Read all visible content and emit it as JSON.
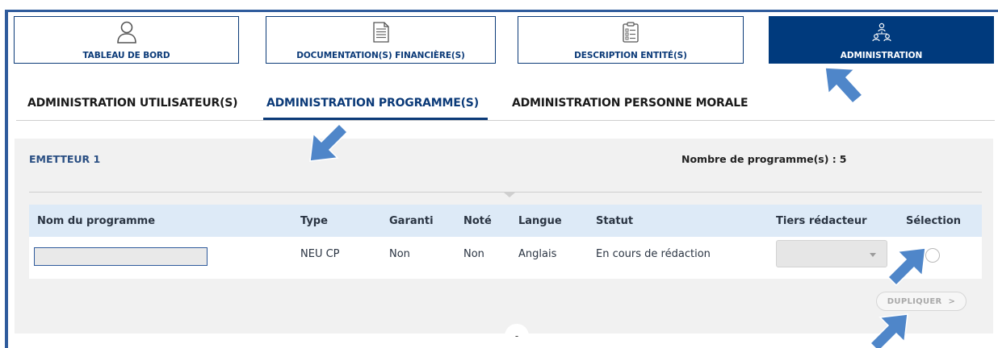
{
  "nav_tiles": [
    {
      "label": "TABLEAU DE BORD",
      "icon": "user-icon",
      "active": false
    },
    {
      "label": "DOCUMENTATION(S) FINANCIÈRE(S)",
      "icon": "document-icon",
      "active": false
    },
    {
      "label": "DESCRIPTION ENTITÉ(S)",
      "icon": "clipboard-icon",
      "active": false
    },
    {
      "label": "ADMINISTRATION",
      "icon": "organization-icon",
      "active": true
    }
  ],
  "subtabs": [
    {
      "label": "ADMINISTRATION UTILISATEUR(S)",
      "active": false
    },
    {
      "label": "ADMINISTRATION PROGRAMME(S)",
      "active": true
    },
    {
      "label": "ADMINISTRATION PERSONNE MORALE",
      "active": false
    }
  ],
  "panel": {
    "emitter": "EMETTEUR 1",
    "count_label": "Nombre de programme(s) :",
    "count_value": "5"
  },
  "table": {
    "columns": [
      "Nom du programme",
      "Type",
      "Garanti",
      "Noté",
      "Langue",
      "Statut",
      "Tiers rédacteur",
      "Sélection"
    ],
    "rows": [
      {
        "name": "",
        "type": "NEU CP",
        "garanti": "Non",
        "note": "Non",
        "langue": "Anglais",
        "statut": "En cours de rédaction",
        "tiers_redacteur": "",
        "selected": false
      }
    ]
  },
  "actions": {
    "duplicate_label": "DUPLIQUER",
    "duplicate_chevron": ">",
    "duplicate_enabled": false
  },
  "collapse_label": "-",
  "colors": {
    "brand_navy": "#003a7d",
    "accent_blue": "#0b3a78",
    "table_header_bg": "#ddeaf7",
    "panel_bg": "#f1f1f1",
    "annotation_arrow": "#4f86c9"
  },
  "annotations": {
    "arrow_icon": "annotation-arrow-icon",
    "arrow_count": 4
  }
}
